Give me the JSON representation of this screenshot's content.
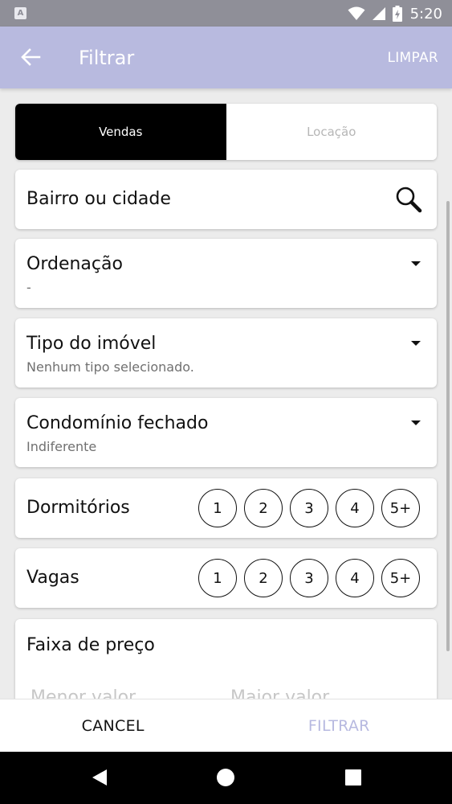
{
  "status_bar": {
    "badge": "A",
    "time": "5:20"
  },
  "app_bar": {
    "title": "Filtrar",
    "clear_label": "LIMPAR"
  },
  "transaction_toggle": {
    "options": [
      "Vendas",
      "Locação"
    ],
    "selected": "Vendas"
  },
  "search": {
    "label": "Bairro ou cidade"
  },
  "ordering": {
    "label": "Ordenação",
    "value": "-"
  },
  "property_type": {
    "label": "Tipo do imóvel",
    "value": "Nenhum tipo selecionado."
  },
  "gated_community": {
    "label": "Condomínio fechado",
    "value": "Indiferente"
  },
  "bedrooms": {
    "label": "Dormitórios",
    "options": [
      "1",
      "2",
      "3",
      "4",
      "5+"
    ]
  },
  "parking": {
    "label": "Vagas",
    "options": [
      "1",
      "2",
      "3",
      "4",
      "5+"
    ]
  },
  "price_range": {
    "label": "Faixa de preço",
    "min_placeholder": "Menor valor",
    "max_placeholder": "Maior valor"
  },
  "actions": {
    "cancel_label": "CANCEL",
    "filter_label": "FILTRAR"
  },
  "colors": {
    "app_bar": "#b8badf",
    "status_bar": "#8f8f98",
    "toggle_active": "#000000",
    "filter_disabled": "#b7b9e0"
  }
}
